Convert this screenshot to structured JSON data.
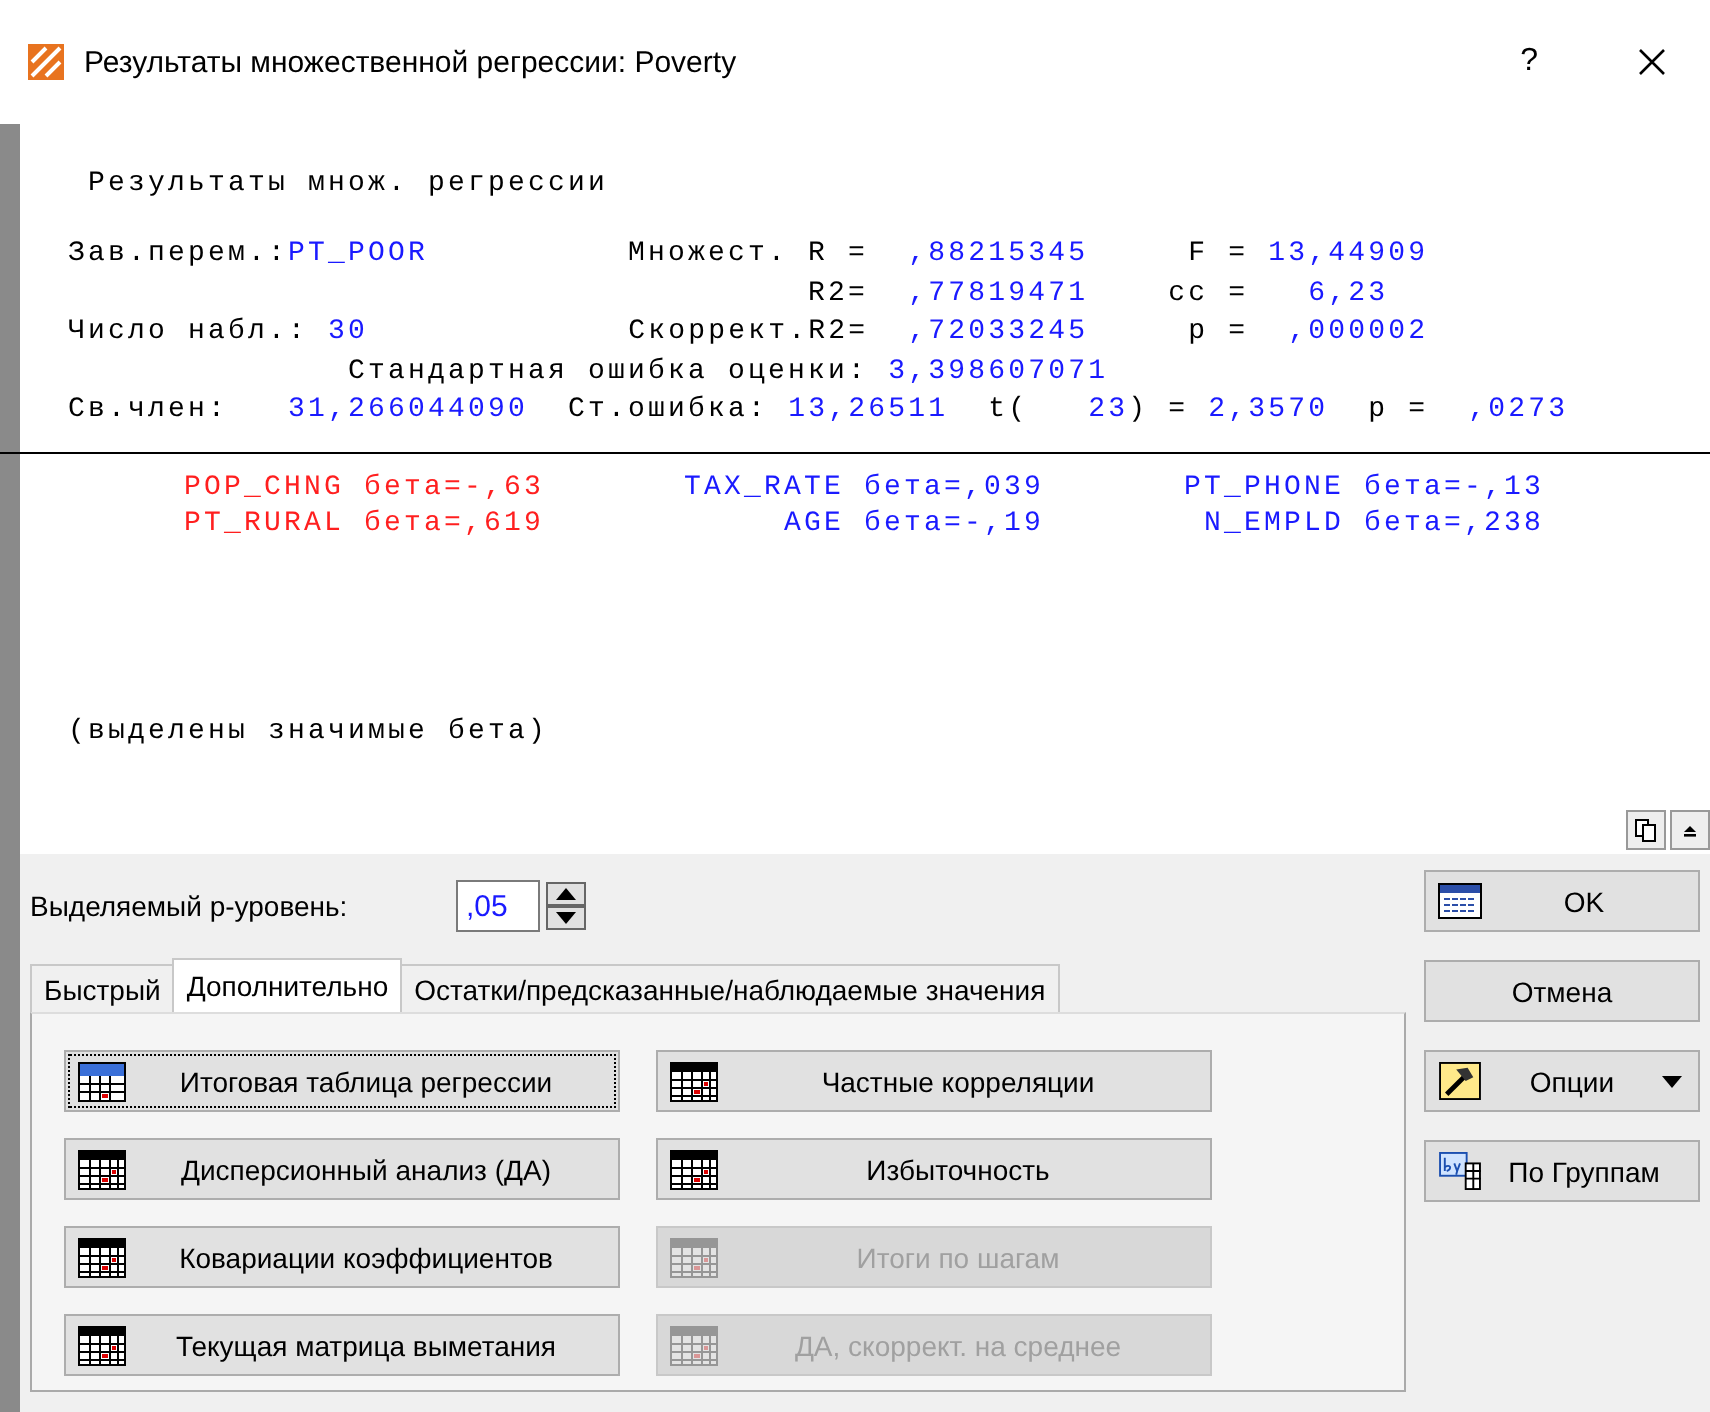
{
  "window": {
    "title": "Результаты множественной регрессии: Poverty",
    "help": "?"
  },
  "output": {
    "heading": "Результаты множ. регрессии",
    "lines": [
      [
        {
          "kind": "label",
          "text": "Зав.перем.:"
        },
        {
          "kind": "value",
          "text": "PT_POOR"
        },
        {
          "kind": "label",
          "text": "          Множест. R =  "
        },
        {
          "kind": "value",
          "text": ",88215345"
        },
        {
          "kind": "label",
          "text": "     F = "
        },
        {
          "kind": "value",
          "text": "13,44909"
        }
      ],
      [
        {
          "kind": "label",
          "text": "                                     R2=  "
        },
        {
          "kind": "value",
          "text": ",77819471"
        },
        {
          "kind": "label",
          "text": "    cc =   "
        },
        {
          "kind": "value",
          "text": "6,23"
        }
      ],
      [
        {
          "kind": "label",
          "text": "Число набл.: "
        },
        {
          "kind": "value",
          "text": "30"
        },
        {
          "kind": "label",
          "text": "             Скоррект.R2=  "
        },
        {
          "kind": "value",
          "text": ",72033245"
        },
        {
          "kind": "label",
          "text": "     p =  "
        },
        {
          "kind": "value",
          "text": ",000002"
        }
      ],
      [
        {
          "kind": "label",
          "text": "              Стандартная ошибка оценки: "
        },
        {
          "kind": "value",
          "text": "3,398607071"
        }
      ],
      [
        {
          "kind": "label",
          "text": "Св.член:   "
        },
        {
          "kind": "value",
          "text": "31,266044090"
        },
        {
          "kind": "label",
          "text": "  Ст.ошибка: "
        },
        {
          "kind": "value",
          "text": "13,26511"
        },
        {
          "kind": "label",
          "text": "  t(   "
        },
        {
          "kind": "value",
          "text": "23"
        },
        {
          "kind": "label",
          "text": ") = "
        },
        {
          "kind": "value",
          "text": "2,3570"
        },
        {
          "kind": "label",
          "text": "  p =  "
        },
        {
          "kind": "value",
          "text": ",0273"
        }
      ]
    ],
    "betas": [
      {
        "text": "POP_CHNG бета=-,63",
        "significant": true
      },
      {
        "text": "TAX_RATE бета=,039",
        "significant": false
      },
      {
        "text": "PT_PHONE бета=-,13",
        "significant": false
      },
      {
        "text": "PT_RURAL бета=,619",
        "significant": true
      },
      {
        "text": "AGE бета=-,19",
        "significant": false
      },
      {
        "text": "N_EMPLD бета=,238",
        "significant": false
      }
    ],
    "note": "(выделены значимые бета)"
  },
  "p_level": {
    "label": "Выделяемый р-уровень:",
    "value": ",05"
  },
  "tabs": [
    {
      "label": "Быстрый",
      "selected": false
    },
    {
      "label": "Дополнительно",
      "selected": true
    },
    {
      "label": "Остатки/предсказанные/наблюдаемые значения",
      "selected": false
    }
  ],
  "buttons": [
    {
      "label": "Итоговая таблица регрессии",
      "kind": "summary",
      "disabled": false,
      "focused": true
    },
    {
      "label": "Частные корреляции",
      "kind": "grid",
      "disabled": false,
      "focused": false
    },
    {
      "label": "Дисперсионный анализ (ДА)",
      "kind": "grid",
      "disabled": false,
      "focused": false
    },
    {
      "label": "Избыточность",
      "kind": "grid",
      "disabled": false,
      "focused": false
    },
    {
      "label": "Ковариации коэффициентов",
      "kind": "grid",
      "disabled": false,
      "focused": false
    },
    {
      "label": "Итоги по шагам",
      "kind": "grid",
      "disabled": true,
      "focused": false
    },
    {
      "label": "Текущая матрица выметания",
      "kind": "grid",
      "disabled": false,
      "focused": false
    },
    {
      "label": "ДА, скоррект. на среднее",
      "kind": "grid",
      "disabled": true,
      "focused": false
    }
  ],
  "side_buttons": [
    {
      "label": "OK",
      "kind": "ok"
    },
    {
      "label": "Отмена",
      "kind": "plain"
    },
    {
      "label": "Опции",
      "kind": "menu"
    },
    {
      "label": "По Группам",
      "kind": "groups"
    }
  ]
}
